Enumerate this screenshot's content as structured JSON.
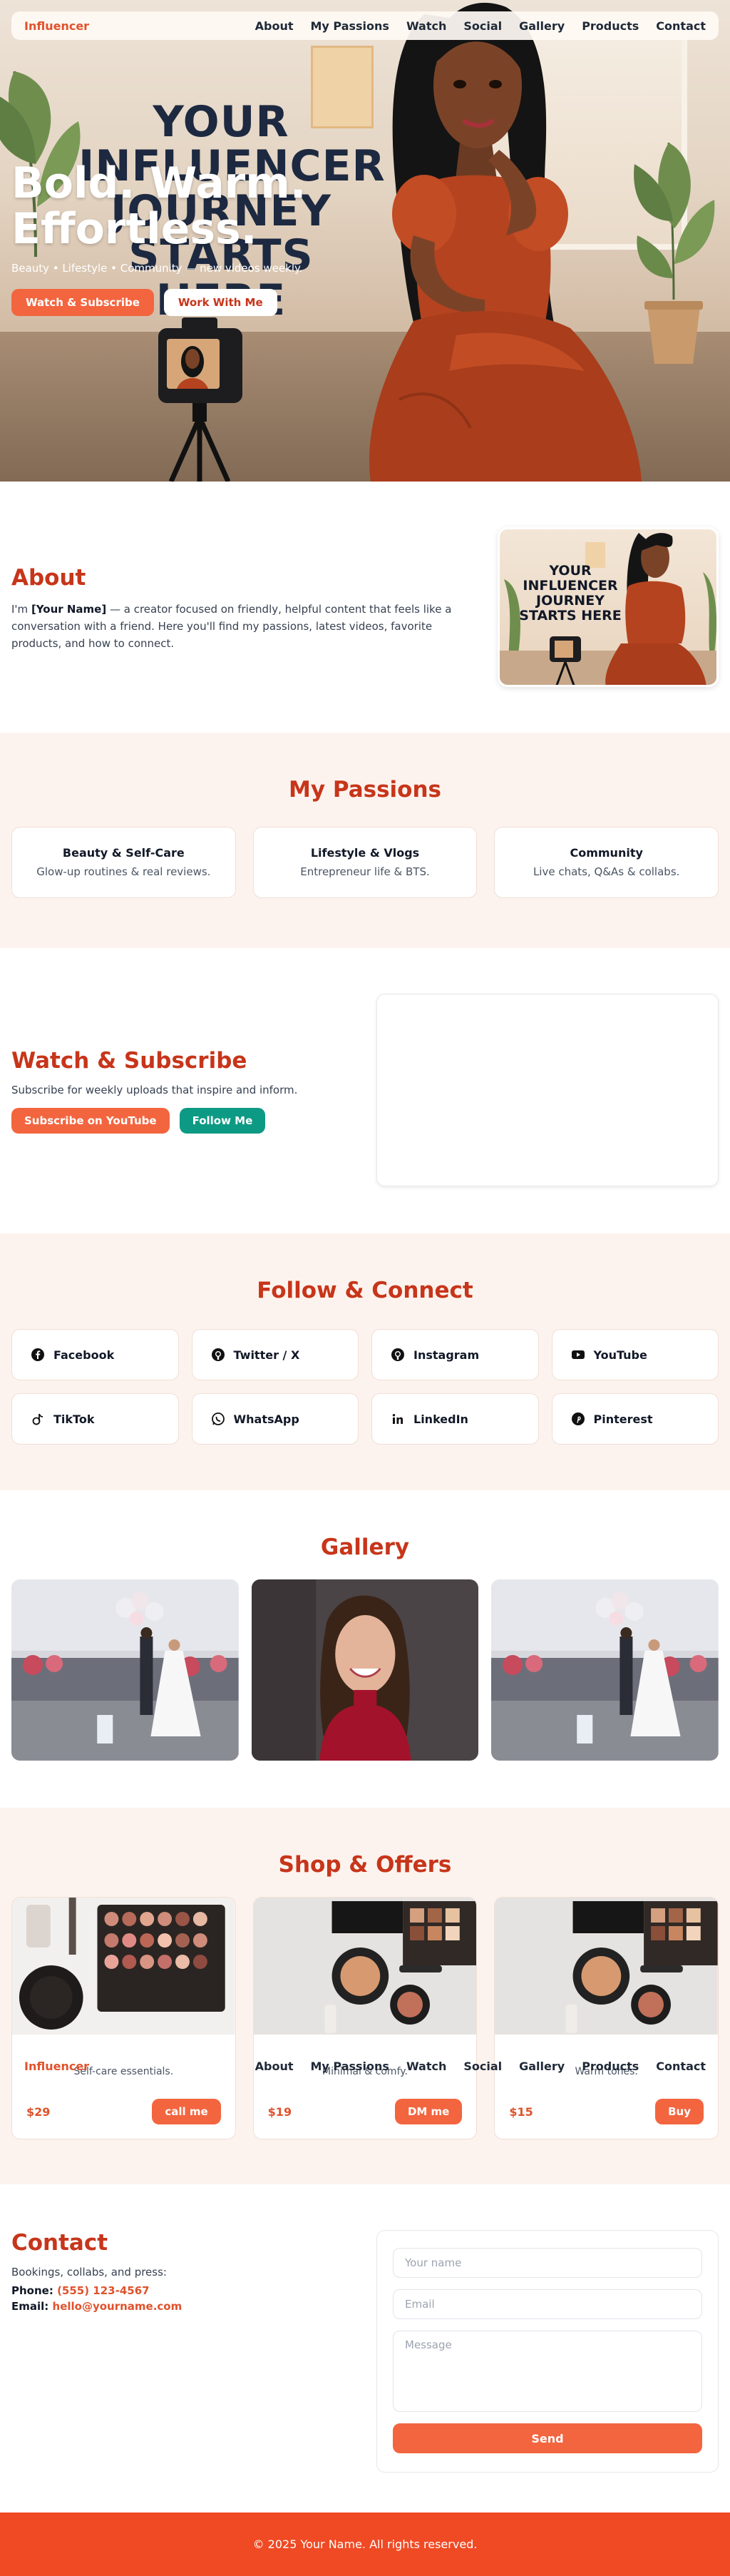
{
  "nav": {
    "brand": "Influencer",
    "links": [
      "About",
      "My Passions",
      "Watch",
      "Social",
      "Gallery",
      "Products",
      "Contact"
    ]
  },
  "hero": {
    "poster_lines": [
      "YOUR",
      "INFLUENCER",
      "JOURNEY",
      "STARTS HERE"
    ],
    "title_line1": "Bold. Warm.",
    "title_line2": "Effortless.",
    "subtitle": "Beauty • Lifestyle • Community — new videos weekly.",
    "primary_button": "Watch & Subscribe",
    "secondary_button": "Work With Me"
  },
  "about": {
    "title": "About",
    "text_before": "I'm ",
    "name": "[Your Name]",
    "text_after": " — a creator focused on friendly, helpful content that feels like a conversation with a friend. Here you'll find my passions, latest videos, favorite products, and how to connect.",
    "card_poster_lines": [
      "YOUR",
      "INFLUENCER",
      "JOURNEY",
      "STARTS HERE"
    ]
  },
  "passions": {
    "title": "My Passions",
    "items": [
      {
        "title": "Beauty & Self-Care",
        "desc": "Glow-up routines & real reviews."
      },
      {
        "title": "Lifestyle & Vlogs",
        "desc": "Entrepreneur life & BTS."
      },
      {
        "title": "Community",
        "desc": "Live chats, Q&As & collabs."
      }
    ]
  },
  "watch": {
    "title": "Watch & Subscribe",
    "desc": "Subscribe for weekly uploads that inspire and inform.",
    "youtube_button": "Subscribe on YouTube",
    "follow_button": "Follow Me"
  },
  "follow": {
    "title": "Follow & Connect",
    "items": [
      {
        "label": "Facebook",
        "icon": "facebook-icon"
      },
      {
        "label": "Twitter / X",
        "icon": "github-icon"
      },
      {
        "label": "Instagram",
        "icon": "github-icon"
      },
      {
        "label": "YouTube",
        "icon": "youtube-icon"
      },
      {
        "label": "TikTok",
        "icon": "tiktok-icon"
      },
      {
        "label": "WhatsApp",
        "icon": "whatsapp-icon"
      },
      {
        "label": "LinkedIn",
        "icon": "linkedin-icon"
      },
      {
        "label": "Pinterest",
        "icon": "pinterest-icon"
      }
    ]
  },
  "gallery": {
    "title": "Gallery",
    "images": [
      "wedding-photo",
      "portrait-photo",
      "wedding-photo"
    ]
  },
  "shop": {
    "title": "Shop & Offers",
    "overlay_nav": {
      "brand": "Influencer",
      "links": [
        "About",
        "My Passions",
        "Watch",
        "Social",
        "Gallery",
        "Products",
        "Contact"
      ]
    },
    "items": [
      {
        "desc": "Self-care essentials.",
        "price": "$29",
        "button": "call me"
      },
      {
        "desc": "Minimal & comfy.",
        "price": "$19",
        "button": "DM me"
      },
      {
        "desc": "Warm tones.",
        "price": "$15",
        "button": "Buy"
      }
    ]
  },
  "contact": {
    "title": "Contact",
    "desc": "Bookings, collabs, and press:",
    "phone_label": "Phone:",
    "phone": "(555) 123-4567",
    "email_label": "Email:",
    "email": "hello@yourname.com",
    "form": {
      "name_placeholder": "Your name",
      "email_placeholder": "Email",
      "message_placeholder": "Message",
      "send_button": "Send"
    }
  },
  "footer": {
    "text": "© 2025 Your Name. All rights reserved."
  },
  "colors": {
    "accent": "#f3653f",
    "heading": "#c7351a",
    "teal": "#0d9a84",
    "footer": "#ef4a24",
    "section_tint": "#fdf3ee"
  }
}
